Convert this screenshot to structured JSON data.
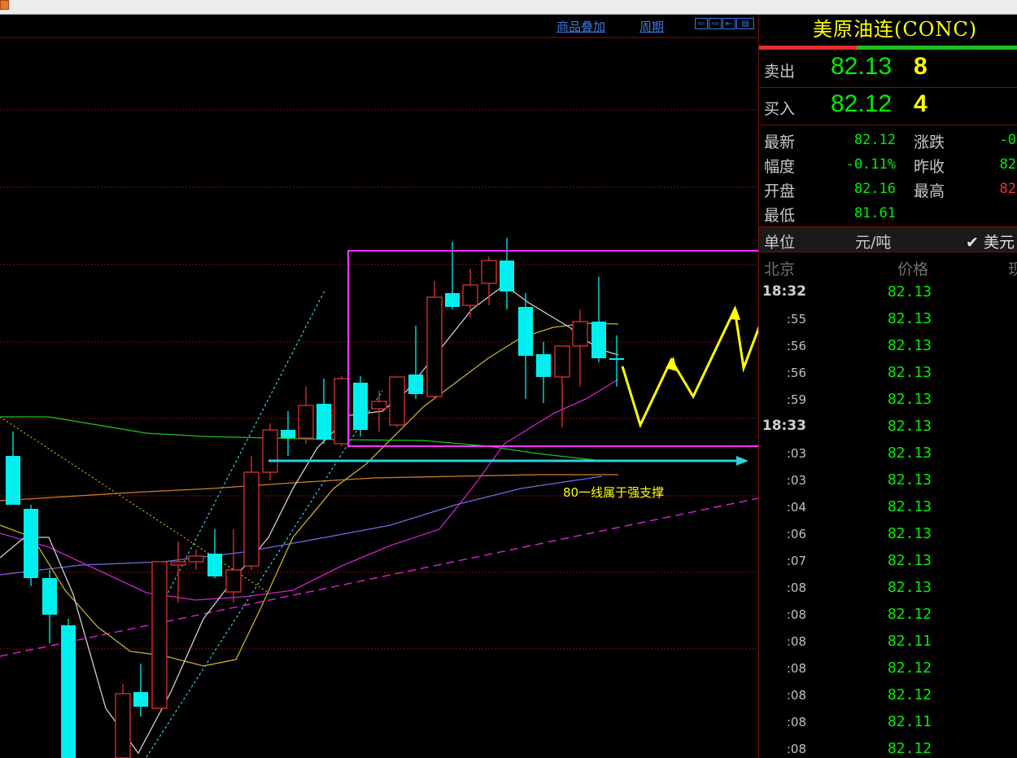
{
  "window": {
    "app_icon": "app-icon"
  },
  "chart_toolbar": {
    "overlay_label": "商品叠加",
    "period_label": "周期"
  },
  "annotation": {
    "text": "80一线属于强支撑"
  },
  "quote": {
    "title": "美原油连(CONC)",
    "ask": {
      "label": "卖出",
      "price": "82.13",
      "volume": "8"
    },
    "bid": {
      "label": "买入",
      "price": "82.12",
      "volume": "4"
    },
    "stats": [
      {
        "label": "最新",
        "value": "82.12",
        "label2": "涨跌",
        "value2": "-0"
      },
      {
        "label": "幅度",
        "value": "-0.11%",
        "label2": "昨收",
        "value2": "82"
      },
      {
        "label": "开盘",
        "value": "82.16",
        "label2": "最高",
        "value2": "82"
      },
      {
        "label": "最低",
        "value": "81.61",
        "label2": "",
        "value2": ""
      }
    ],
    "unit_label": "单位",
    "unit_value": "元/吨",
    "currency": "✔ 美元",
    "col_time": "北京",
    "col_price": "价格",
    "col_extra": "现",
    "ticks": [
      {
        "time": "18:32",
        "price": "82.13",
        "hour": true
      },
      {
        "time": ":55",
        "price": "82.13"
      },
      {
        "time": ":56",
        "price": "82.13"
      },
      {
        "time": ":56",
        "price": "82.13"
      },
      {
        "time": ":59",
        "price": "82.13"
      },
      {
        "time": "18:33",
        "price": "82.13",
        "hour": true
      },
      {
        "time": ":03",
        "price": "82.13"
      },
      {
        "time": ":03",
        "price": "82.13"
      },
      {
        "time": ":04",
        "price": "82.13"
      },
      {
        "time": ":06",
        "price": "82.13"
      },
      {
        "time": ":07",
        "price": "82.13"
      },
      {
        "time": ":08",
        "price": "82.13"
      },
      {
        "time": ":08",
        "price": "82.12"
      },
      {
        "time": ":08",
        "price": "82.11"
      },
      {
        "time": ":08",
        "price": "82.12"
      },
      {
        "time": ":08",
        "price": "82.12"
      },
      {
        "time": ":08",
        "price": "82.11"
      },
      {
        "time": ":08",
        "price": "82.12"
      }
    ]
  },
  "colors": {
    "up": "#e03030",
    "down": "#00f0f0",
    "price_green": "#00ee00",
    "highlight": "#ff30ff",
    "annotation": "#ffff00"
  }
}
